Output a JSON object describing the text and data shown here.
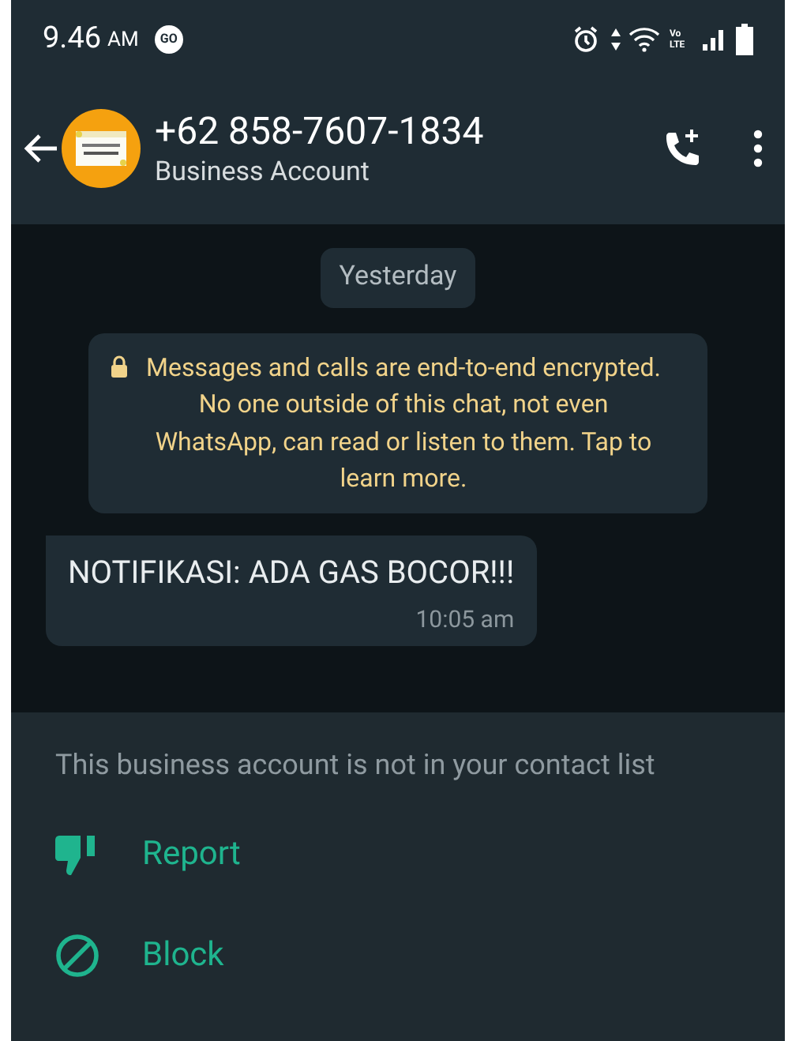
{
  "status_bar": {
    "time": "9.46",
    "ampm": "AM",
    "app_badge": "GO",
    "volte": "Vo LTE"
  },
  "header": {
    "title": "+62 858-7607-1834",
    "subtitle": "Business Account"
  },
  "date_chip": "Yesterday",
  "encryption_notice": "Messages and calls are end-to-end encrypted. No one outside of this chat, not even WhatsApp, can read or listen to them. Tap to learn more.",
  "messages": [
    {
      "text": "NOTIFIKASI: ADA GAS BOCOR!!!",
      "time": "10:05 am"
    }
  ],
  "panel": {
    "notice": "This business account is not in your contact list",
    "actions": [
      {
        "kind": "report",
        "label": "Report"
      },
      {
        "kind": "block",
        "label": "Block"
      }
    ]
  }
}
